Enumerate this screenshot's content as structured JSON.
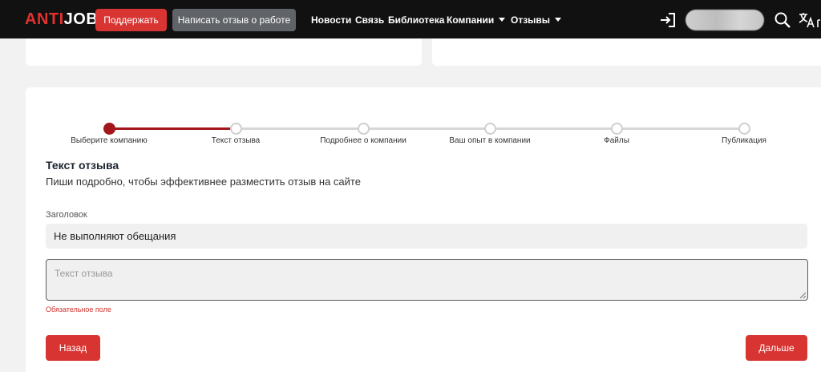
{
  "header": {
    "logo_left": "ANTI",
    "logo_right": "JOB",
    "support_label": "Поддержать",
    "write_review_label": "Написать отзыв о работе",
    "nav": [
      "Новости",
      "Связь",
      "Библиотека",
      "Компании",
      "Отзывы"
    ],
    "icons": [
      "login-icon",
      "search-icon",
      "translate-icon"
    ]
  },
  "stepper": {
    "steps": [
      "Выберите компанию",
      "Текст отзыва",
      "Подробнее о компании",
      "Ваш опыт в компании",
      "Файлы",
      "Публикация"
    ],
    "current_step": 1
  },
  "form": {
    "title": "Текст отзыва",
    "subtitle": "Пиши подробно, чтобы эффективнее разместить отзыв на сайте",
    "heading_label": "Заголовок",
    "heading_value": "Не выполняют обещания",
    "text_placeholder": "Текст отзыва",
    "error": "Обязательное поле",
    "back_label": "Назад",
    "next_label": "Дальше"
  },
  "colors": {
    "accent": "#d83532",
    "step_active": "#a3161c",
    "step_inactive": "#cfcfcf",
    "topbar": "#111111"
  }
}
